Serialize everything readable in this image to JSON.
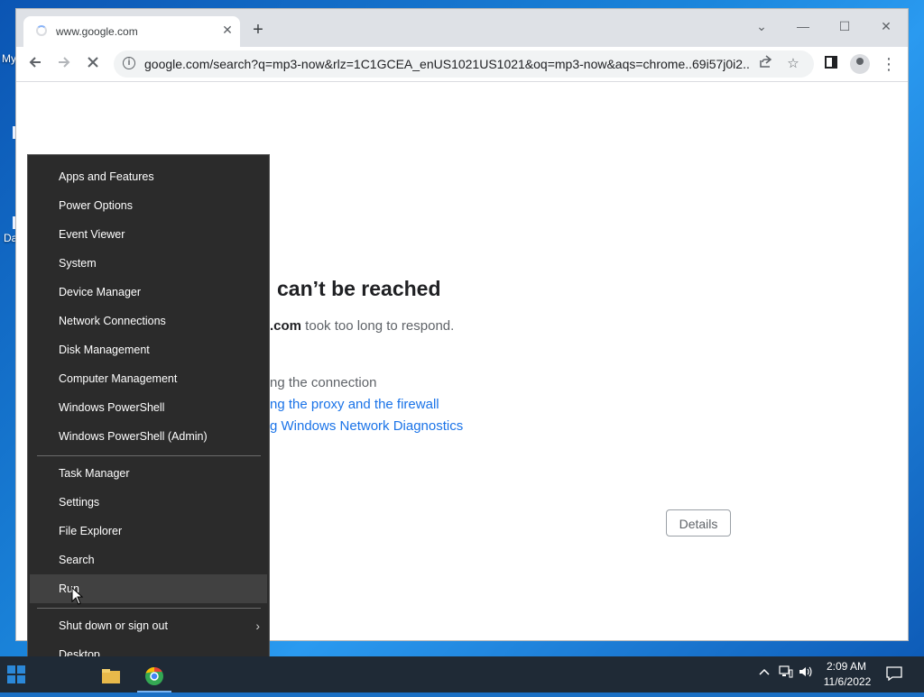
{
  "desktop": {
    "icon_labels": [
      "My",
      "Da"
    ]
  },
  "browser": {
    "tab_title": "www.google.com",
    "tab_close": "✕",
    "new_tab": "+",
    "url": "google.com/search?q=mp3-now&rlz=1C1GCEA_enUS1021US1021&oq=mp3-now&aqs=chrome..69i57j0i2...",
    "window_controls": {
      "dropdown": "⌄",
      "minimize": "—",
      "maximize": "☐",
      "close": "✕"
    }
  },
  "error_page": {
    "title": "can’t be reached",
    "desc_bold": ".com",
    "desc_rest": " took too long to respond.",
    "try_lines": [
      {
        "text": "ng the connection",
        "kind": "plain"
      },
      {
        "text": "ng the proxy and the firewall",
        "kind": "link"
      },
      {
        "text": "g Windows Network Diagnostics",
        "kind": "link"
      }
    ],
    "details_button": "Details"
  },
  "context_menu": {
    "group1": [
      "Apps and Features",
      "Power Options",
      "Event Viewer",
      "System",
      "Device Manager",
      "Network Connections",
      "Disk Management",
      "Computer Management",
      "Windows PowerShell",
      "Windows PowerShell (Admin)"
    ],
    "group2": [
      "Task Manager",
      "Settings",
      "File Explorer",
      "Search",
      "Run"
    ],
    "group3": [
      "Shut down or sign out",
      "Desktop"
    ],
    "highlighted": "Run",
    "submenu_arrow": "›"
  },
  "taskbar": {
    "clock_time": "2:09 AM",
    "clock_date": "11/6/2022"
  },
  "colors": {
    "menu_bg": "#2b2b2b",
    "menu_hover": "#414141",
    "link": "#1a73e8",
    "taskbar": "#1f2a36"
  }
}
